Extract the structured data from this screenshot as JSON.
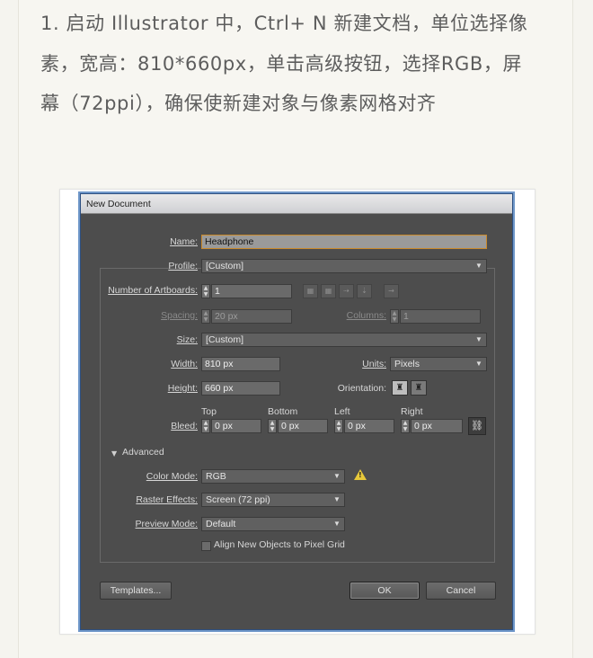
{
  "instruction_text": "1. 启动 Illustrator 中，Ctrl+ N 新建文档，单位选择像素，宽高：810*660px，单击高级按钮，选择RGB，屏幕（72ppi），确保使新建对象与像素网格对齐",
  "dialog": {
    "title": "New Document",
    "name_label": "Name:",
    "name_value": "Headphone",
    "profile_label": "Profile:",
    "profile_value": "[Custom]",
    "artboards_label": "Number of Artboards:",
    "artboards_value": "1",
    "spacing_label": "Spacing:",
    "spacing_value": "20 px",
    "columns_label": "Columns:",
    "columns_value": "1",
    "size_label": "Size:",
    "size_value": "[Custom]",
    "width_label": "Width:",
    "width_value": "810 px",
    "units_label": "Units:",
    "units_value": "Pixels",
    "height_label": "Height:",
    "height_value": "660 px",
    "orientation_label": "Orientation:",
    "bleed_label": "Bleed:",
    "bleed_top_label": "Top",
    "bleed_bottom_label": "Bottom",
    "bleed_left_label": "Left",
    "bleed_right_label": "Right",
    "bleed_top": "0 px",
    "bleed_bottom": "0 px",
    "bleed_left": "0 px",
    "bleed_right": "0 px",
    "advanced_label": "Advanced",
    "color_mode_label": "Color Mode:",
    "color_mode_value": "RGB",
    "raster_label": "Raster Effects:",
    "raster_value": "Screen (72 ppi)",
    "preview_label": "Preview Mode:",
    "preview_value": "Default",
    "align_label": "Align New Objects to Pixel Grid",
    "templates_button": "Templates...",
    "ok_button": "OK",
    "cancel_button": "Cancel"
  },
  "colors": {
    "dialog_bg": "#4d4d4d",
    "accent_blue": "#5f8bc7",
    "warning": "#e7c83a"
  }
}
